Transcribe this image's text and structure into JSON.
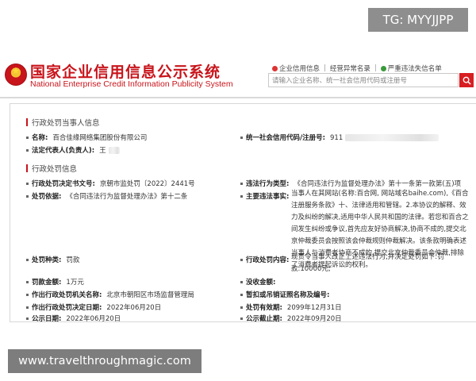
{
  "overlay": {
    "tg_badge": "TG: MYYJJPP",
    "watermark_bottom": "www.travelthroughmagic.com"
  },
  "header": {
    "title_cn": "国家企业信用信息公示系统",
    "title_en": "National Enterprise Credit Information Publicity System",
    "nav": [
      {
        "label": "企业信用信息",
        "icon": "red-dot-icon"
      },
      {
        "label": "经营异常名录"
      },
      {
        "label": "严重违法失信名单",
        "icon": "green-dot-icon"
      }
    ],
    "search_placeholder": "请输入企业名称、统一社会信用代码或注册号",
    "search_button_icon": "search-icon"
  },
  "party_section": {
    "heading": "行政处罚当事人信息",
    "name_label": "名称:",
    "name_value": "百合佳缘网络集团股份有限公司",
    "credit_code_label": "统一社会信用代码/注册号:",
    "credit_code_value": "911",
    "legal_rep_label": "法定代表人(负责人):",
    "legal_rep_value": "王"
  },
  "penalty_section": {
    "heading": "行政处罚信息",
    "decision_no_label": "行政处罚决定书文号:",
    "decision_no_value": "京朝市监处罚〔2022〕2441号",
    "basis_label": "处罚依据:",
    "basis_value": "《合同违法行为监督处理办法》第十二条",
    "violation_type_label": "违法行为类型:",
    "violation_type_value": "《合同违法行为监督处理办法》第十一条第一款第(五)项",
    "main_facts_label": "主要违法事实:",
    "main_facts_value": "当事人在其网站(名称:百合网, 网站域名baihe.com),《百合注册服务条款》十、法律适用和管辖。2.本协议的解释、效力及纠纷的解决,适用中华人民共和国的法律。若您和百合之间发生纠纷或争议,首先应友好协商解决,协商不成的,提交北京仲裁委员会按照该会仲裁规则仲裁解决。该条款明确表述当事人与消费者协商不成的,提交北京仲裁委员会仲裁,排除了消费者提起诉讼的权利。",
    "penalty_type_label": "处罚种类:",
    "penalty_type_value": "罚款",
    "penalty_content_label": "行政处罚内容:",
    "penalty_content_value": "现责令当事人改正上述违法行为,并决定处罚如下:罚款:10000元;",
    "fine_label": "罚款金额:",
    "fine_value": "1万元",
    "confiscation_label": "没收金额:",
    "confiscation_value": "",
    "authority_label": "作出行政处罚机关名称:",
    "authority_value": "北京市朝阳区市场监督管理局",
    "ref_label": "暂扣或吊销证照名称及编号:",
    "ref_value": "",
    "decision_date_label": "作出行政处罚决定日期:",
    "decision_date_value": "2022年06月20日",
    "valid_until_label": "处罚有效期:",
    "valid_until_value": "2099年12月31日",
    "publish_date_label": "公示日期:",
    "publish_date_value": "2022年06月20日",
    "publish_end_label": "公示截止期:",
    "publish_end_value": "2022年09月20日"
  }
}
